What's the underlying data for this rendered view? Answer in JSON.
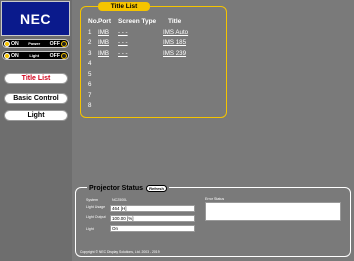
{
  "sidebar": {
    "logo": "NEC",
    "power_toggle": {
      "on": "ON",
      "label": "Power",
      "off": "OFF"
    },
    "light_toggle": {
      "on": "ON",
      "label": "Light",
      "off": "OFF"
    },
    "nav": [
      {
        "label": "Title List",
        "active": true
      },
      {
        "label": "Basic Control",
        "active": false
      },
      {
        "label": "Light",
        "active": false
      }
    ]
  },
  "title_list": {
    "tab": "Title List",
    "headers": {
      "no": "No.",
      "port": "Port",
      "screen_type": "Screen Type",
      "title": "Title"
    },
    "rows": [
      {
        "no": "1",
        "port": "IMB",
        "screen_type": "- - -",
        "title": "IMS Auto"
      },
      {
        "no": "2",
        "port": "IMB",
        "screen_type": "- - -",
        "title": "IMS 185"
      },
      {
        "no": "3",
        "port": "IMB",
        "screen_type": "- - -",
        "title": "IMS 239"
      },
      {
        "no": "4",
        "port": "",
        "screen_type": "",
        "title": ""
      },
      {
        "no": "5",
        "port": "",
        "screen_type": "",
        "title": ""
      },
      {
        "no": "6",
        "port": "",
        "screen_type": "",
        "title": ""
      },
      {
        "no": "7",
        "port": "",
        "screen_type": "",
        "title": ""
      },
      {
        "no": "8",
        "port": "",
        "screen_type": "",
        "title": ""
      }
    ]
  },
  "projector_status": {
    "title": "Projector Status",
    "refresh": "Refresh",
    "system_label": "System",
    "system_value": "NC2500L",
    "light_usage_label": "Light Usage",
    "light_usage_value": "464 [H]",
    "light_output_label": "Light Output",
    "light_output_value": "100.00 [%]",
    "light_label": "Light",
    "light_value": "On",
    "error_label": "Error Status",
    "copyright": "Copyright © NEC Display Solutions, Ltd. 2003 - 2019"
  },
  "colors": {
    "accent": "#f5c400",
    "logo_bg": "#0a1a8c",
    "active_nav": "#d0021b",
    "sidebar_bg": "#6e6e6e",
    "main_bg": "#7a7a7a"
  }
}
